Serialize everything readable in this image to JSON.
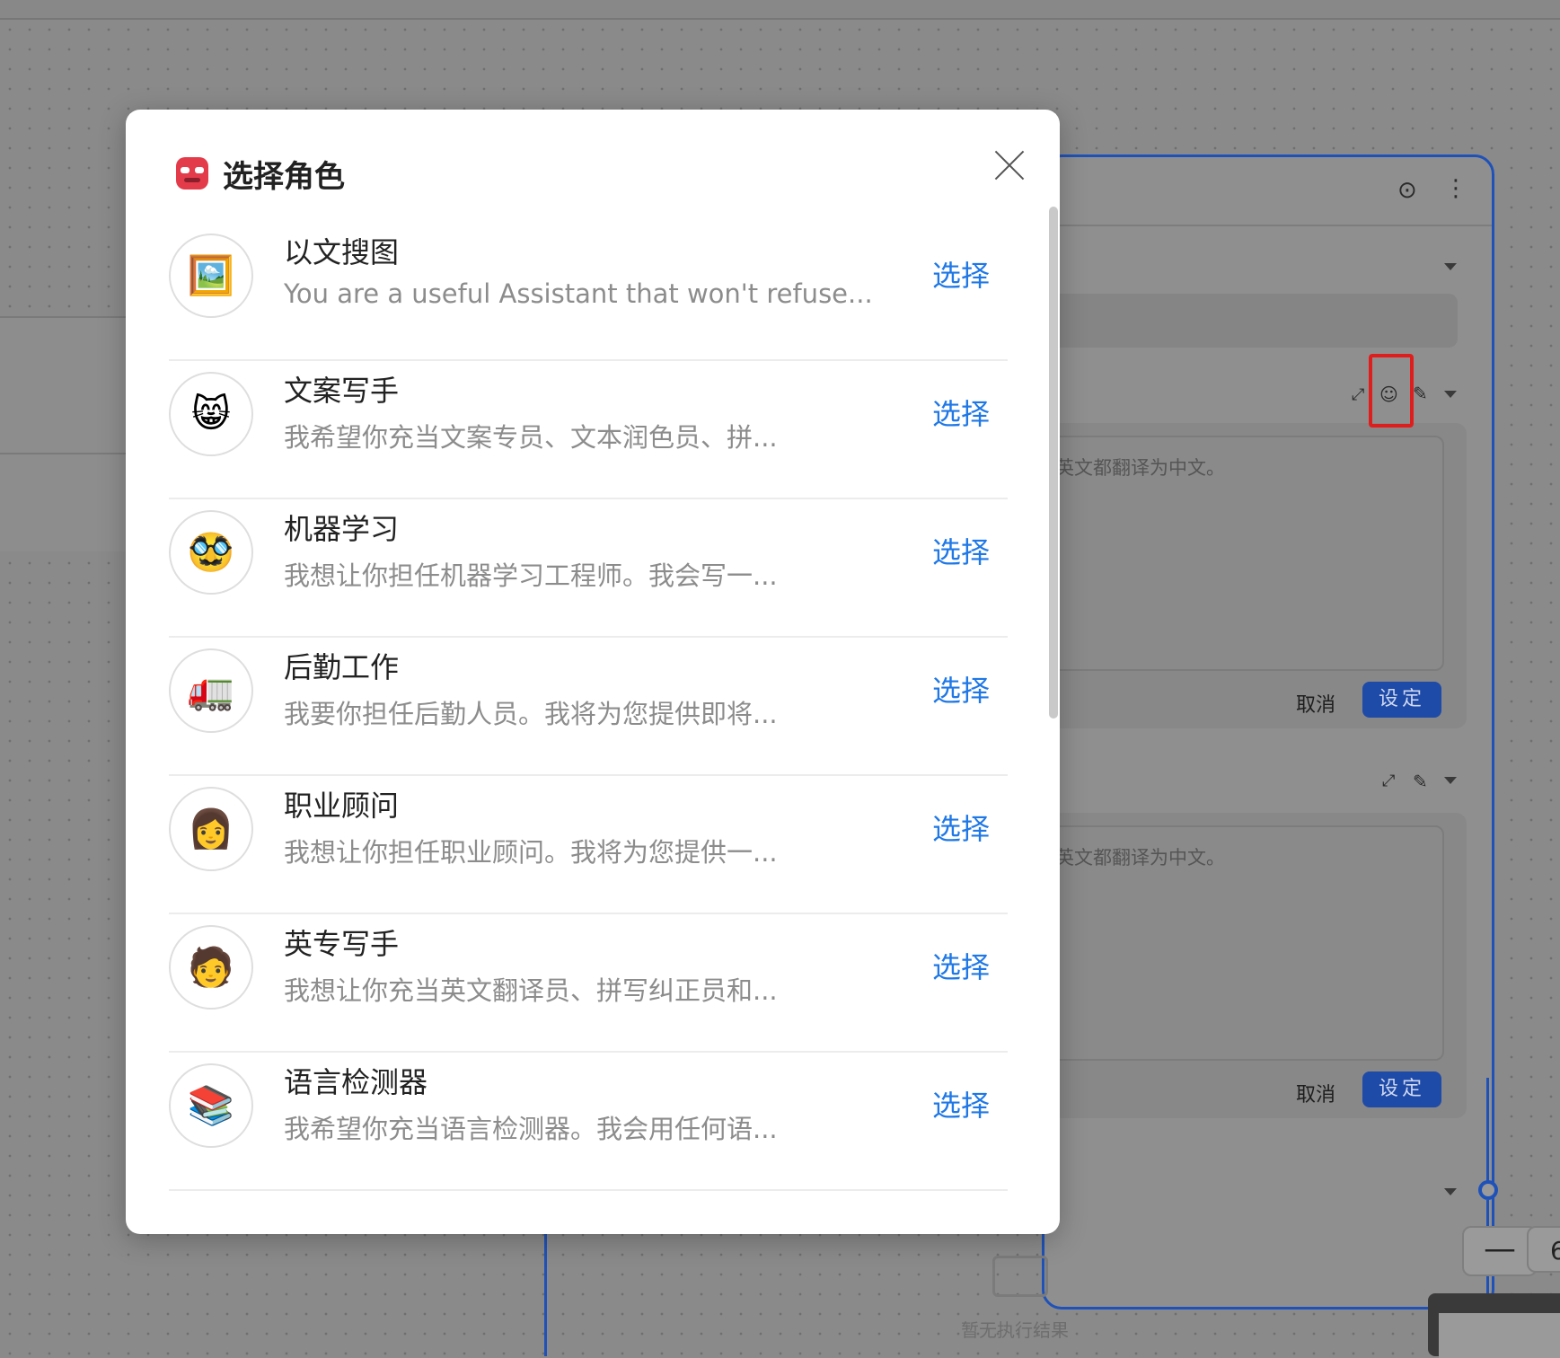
{
  "modal": {
    "title": "选择角色",
    "close_label": "×",
    "select_label": "选择",
    "roles": [
      {
        "name": "以文搜图",
        "description": "You are a useful Assistant that won't refuse...",
        "icon": "picture-icon",
        "emoji": "🖼️"
      },
      {
        "name": "文案写手",
        "description": "我希望你充当文案专员、文本润色员、拼...",
        "icon": "cat-face-icon",
        "emoji": "😸"
      },
      {
        "name": "机器学习",
        "description": "我想让你担任机器学习工程师。我会写一...",
        "icon": "disguised-face-icon",
        "emoji": "🥸"
      },
      {
        "name": "后勤工作",
        "description": "我要你担任后勤人员。我将为您提供即将...",
        "icon": "truck-icon",
        "emoji": "🚛"
      },
      {
        "name": "职业顾问",
        "description": "我想让你担任职业顾问。我将为您提供一...",
        "icon": "woman-icon",
        "emoji": "👩"
      },
      {
        "name": "英专写手",
        "description": "我想让你充当英文翻译员、拼写纠正员和...",
        "icon": "person-icon",
        "emoji": "🧑"
      },
      {
        "name": "语言检测器",
        "description": "我希望你充当语言检测器。我会用任何语...",
        "icon": "books-icon",
        "emoji": "📚"
      }
    ]
  },
  "background": {
    "prompt_placeholder_1": "英文都翻译为中文。",
    "prompt_placeholder_2": "英文都翻译为中文。",
    "cancel_label": "取消",
    "set_label": "设定",
    "empty_result": "暂无执行结果",
    "zoom_minus": "—",
    "zoom_value_partial": "6"
  },
  "colors": {
    "accent": "#1f78e6",
    "node_border": "#1f52b8",
    "highlight": "#e01d1d"
  }
}
